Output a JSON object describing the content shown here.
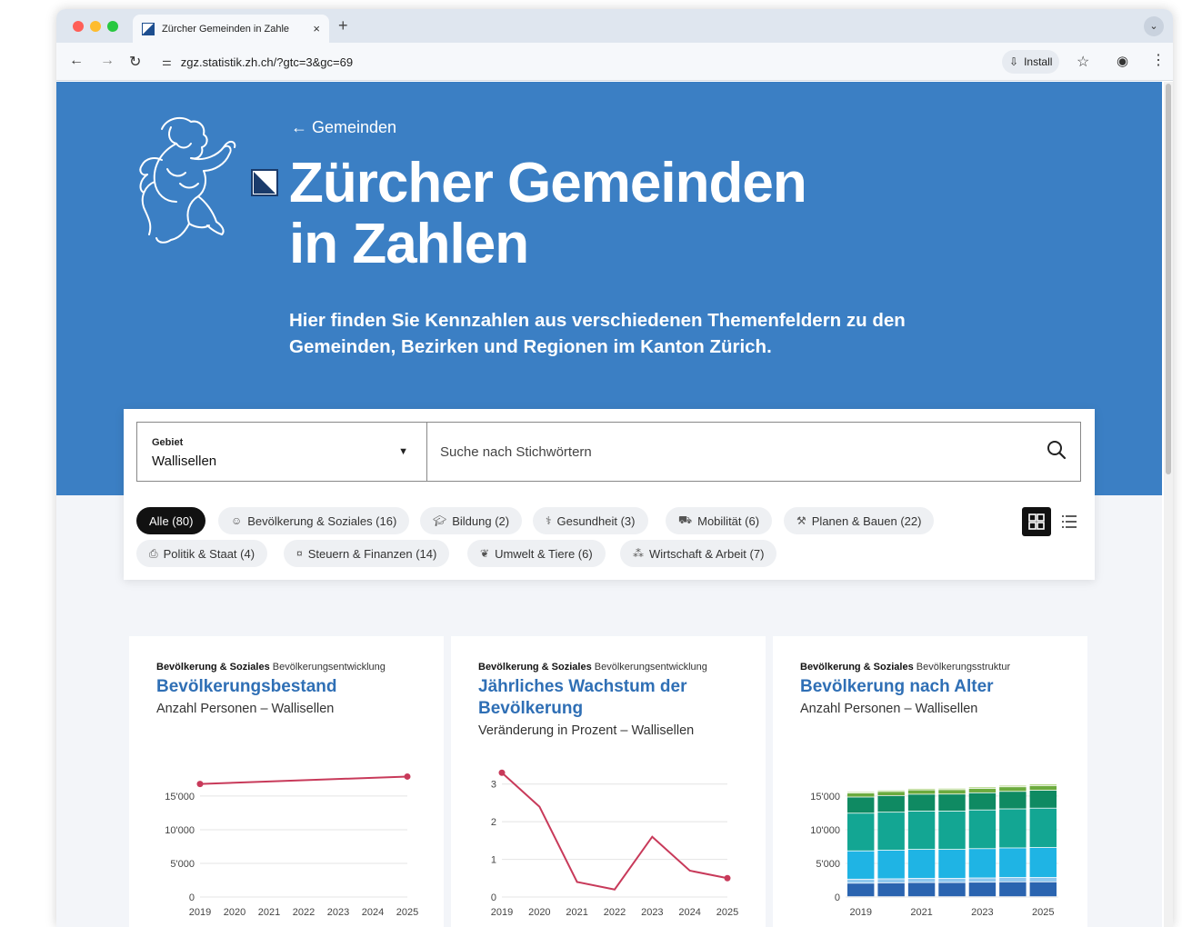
{
  "browser": {
    "tab_title": "Zürcher Gemeinden in Zahle",
    "tab_close": "×",
    "new_tab": "+",
    "url": "zgz.statistik.zh.ch/?gtc=3&gc=69",
    "install_label": "Install"
  },
  "hero": {
    "back_link": "← Gemeinden",
    "title_line1": "Zürcher Gemeinden",
    "title_line2": "in Zahlen",
    "subtitle": "Hier finden Sie Kennzahlen aus verschiedenen Themenfeldern zu den Gemeinden, Bezirken und Regionen im Kanton Zürich."
  },
  "filter": {
    "gebiet_label": "Gebiet",
    "gebiet_value": "Wallisellen",
    "search_placeholder": "Suche nach Stichwörtern",
    "chips": [
      {
        "label": "Alle (80)",
        "icon": "",
        "active": true
      },
      {
        "label": "Bevölkerung & Soziales (16)",
        "icon": "people-icon",
        "active": false
      },
      {
        "label": "Bildung (2)",
        "icon": "graduation-icon",
        "active": false
      },
      {
        "label": "Gesundheit (3)",
        "icon": "stethoscope-icon",
        "active": false
      },
      {
        "label": "Mobilität (6)",
        "icon": "car-icon",
        "active": false
      },
      {
        "label": "Planen & Bauen (22)",
        "icon": "crane-icon",
        "active": false
      },
      {
        "label": "Politik & Staat (4)",
        "icon": "ballot-icon",
        "active": false
      },
      {
        "label": "Steuern & Finanzen (14)",
        "icon": "money-icon",
        "active": false
      },
      {
        "label": "Umwelt & Tiere (6)",
        "icon": "leaf-icon",
        "active": false
      },
      {
        "label": "Wirtschaft & Arbeit (7)",
        "icon": "people-network-icon",
        "active": false
      }
    ]
  },
  "cards": [
    {
      "category": "Bevölkerung & Soziales",
      "subcategory": "Bevölkerungsentwicklung",
      "title": "Bevölkerungsbestand",
      "subtitle": "Anzahl Personen – Wallisellen"
    },
    {
      "category": "Bevölkerung & Soziales",
      "subcategory": "Bevölkerungsentwicklung",
      "title": "Jährliches Wachstum der Bevölkerung",
      "subtitle": "Veränderung in Prozent – Wallisellen"
    },
    {
      "category": "Bevölkerung & Soziales",
      "subcategory": "Bevölkerungsstruktur",
      "title": "Bevölkerung nach Alter",
      "subtitle": "Anzahl Personen – Wallisellen"
    }
  ],
  "chart_data": [
    {
      "type": "line",
      "x": [
        "2019",
        "2020",
        "2021",
        "2022",
        "2023",
        "2024",
        "2025"
      ],
      "x_positions": [
        2019,
        2025
      ],
      "series": [
        {
          "values": [
            [
              2019,
              16800
            ],
            [
              2025,
              17900
            ]
          ],
          "color": "#c83a5a"
        }
      ],
      "yticks": [
        "0",
        "5'000",
        "10'000",
        "15'000"
      ],
      "ylim": [
        0,
        18500
      ]
    },
    {
      "type": "line",
      "x": [
        "2019",
        "2020",
        "2021",
        "2022",
        "2023",
        "2024",
        "2025"
      ],
      "series": [
        {
          "values": [
            3.3,
            2.4,
            0.4,
            0.2,
            1.6,
            0.7,
            0.5
          ],
          "color": "#c83a5a"
        }
      ],
      "yticks": [
        "0",
        "1",
        "2",
        "3"
      ],
      "ylim": [
        0,
        3.5
      ]
    },
    {
      "type": "bar",
      "stacked": true,
      "categories": [
        "2019",
        "2020",
        "2021",
        "2022",
        "2023",
        "2024",
        "2025"
      ],
      "xticks": [
        "2019",
        "2021",
        "2023",
        "2025"
      ],
      "yticks": [
        "0",
        "5'000",
        "10'000",
        "15'000"
      ],
      "ylim": [
        0,
        18500
      ],
      "series": [
        {
          "color": "#2a64b0",
          "values": [
            2000,
            2050,
            2100,
            2100,
            2150,
            2200,
            2200
          ]
        },
        {
          "color": "#8fc7ee",
          "values": [
            600,
            600,
            620,
            620,
            630,
            640,
            650
          ]
        },
        {
          "color": "#1fb4e4",
          "values": [
            4200,
            4250,
            4300,
            4300,
            4350,
            4400,
            4450
          ]
        },
        {
          "color": "#13a693",
          "values": [
            5600,
            5650,
            5700,
            5700,
            5750,
            5800,
            5850
          ]
        },
        {
          "color": "#0f8a62",
          "values": [
            2400,
            2450,
            2500,
            2520,
            2550,
            2600,
            2650
          ]
        },
        {
          "color": "#6cab3e",
          "values": [
            600,
            620,
            640,
            650,
            660,
            680,
            700
          ]
        },
        {
          "color": "#b7d88c",
          "values": [
            200,
            210,
            220,
            220,
            230,
            240,
            250
          ]
        }
      ]
    }
  ]
}
